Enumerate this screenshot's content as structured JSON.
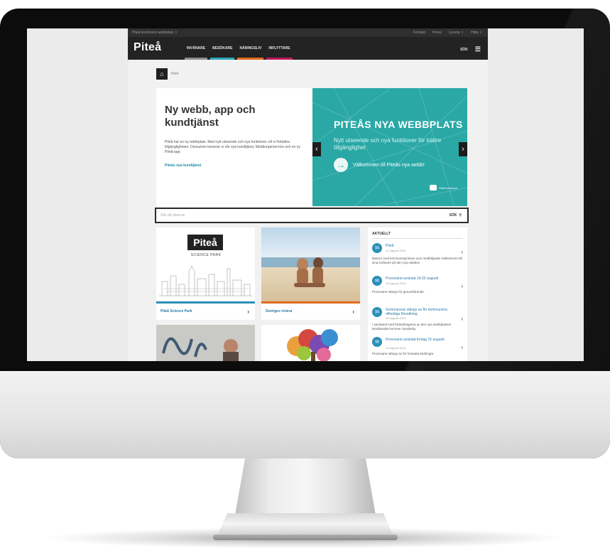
{
  "site": {
    "utility_left": "Piteå kommuns webbplats ⇩",
    "utility_right": [
      "Kontakt",
      "Press",
      "Lyssna ⇩",
      "Hitta ⇩"
    ],
    "logo": "Piteå",
    "nav": [
      {
        "label": "INVÅNARE",
        "color": "#8c8c8c"
      },
      {
        "label": "BESÖKARE",
        "color": "#2aa8b8"
      },
      {
        "label": "NÄRINGSLIV",
        "color": "#e36a1e"
      },
      {
        "label": "INFLYTTARE",
        "color": "#c0185f"
      }
    ],
    "nav_search": "SÖK",
    "nav_menu": "☰",
    "breadcrumb": "Hem",
    "home_icon": "⌂"
  },
  "hero": {
    "title": "Ny webb, app och kundtjänst",
    "description": "Piteå har en ny webbplats. Med nytt utseende och nya funktioner vill vi förbättra tillgängligheten. Dessutom lanserar vi vår nya kundtjänst, Medborgarservice och en ny Piteå-app.",
    "link": "Piteås nya kundtjänst",
    "image_heading": "PITEÅS NYA WEBBPLATS",
    "image_sub": "Nytt utseende och nya funktioner för bättre tillgänglighet",
    "image_cta": "Välkommen till Piteås nya webb!",
    "image_brand": "Piteå kommun",
    "prev": "‹",
    "next": "›",
    "accent": "#2aa8a6"
  },
  "search": {
    "placeholder": "Sök på pitea.se",
    "button": "SÖK",
    "icon": "⚲"
  },
  "cards": [
    {
      "label": "Piteå Science Park",
      "logo": "Piteå",
      "sub": "SCIENCE PARK",
      "bar": "#2a8fb8"
    },
    {
      "label": "Sveriges riviera",
      "bar": "#e36a1e"
    }
  ],
  "news": {
    "heading": "AKTUELLT",
    "items": [
      {
        "title": "Piteå",
        "date": "21 augusti 2014",
        "text": "Bakom med kommunstyrelsen som medföljande Välkommen till sina invånare på den nya webben"
      },
      {
        "title": "Provsvaret avslutat 19-20 augusti",
        "date": "18 augusti 2014",
        "text": "Provsvaret stängs för genomförande."
      },
      {
        "title": "Sommarsvar stängs av för kommunens offentliga förvaltning",
        "date": "15 augusti 2014",
        "text": "I samband med förändringarna av den nya webbplatsen Bredbandet kommer Sunderby."
      },
      {
        "title": "Provsvaret avslutat fredag 15 augusti",
        "date": "15 augusti 2014",
        "text": "Provsvaret stängs av för fortsatta ändringar."
      }
    ],
    "chev": "›"
  }
}
